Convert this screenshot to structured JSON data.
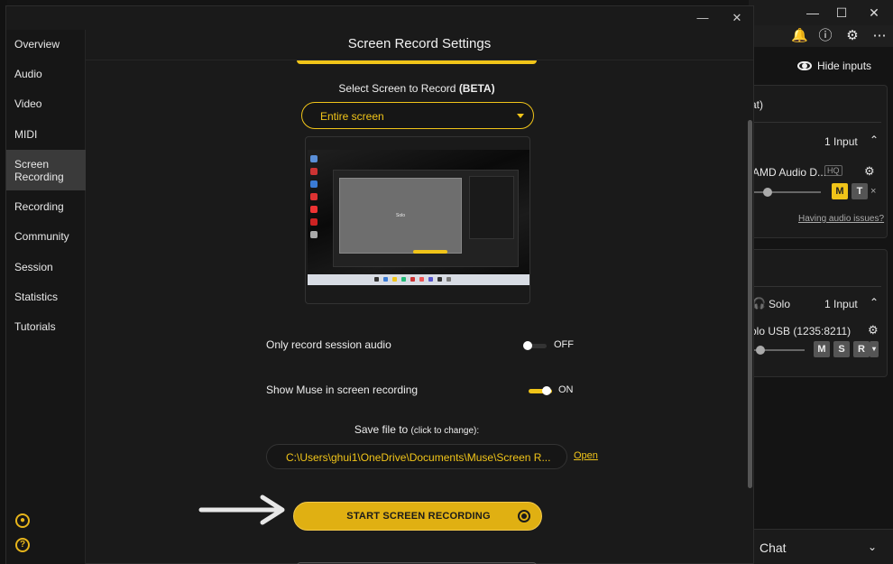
{
  "background_app": {
    "hide_inputs_label": "Hide inputs",
    "input1": {
      "title_fragment": "at)",
      "count": "1 Input",
      "device": "AMD Audio D...",
      "hq": "HQ",
      "mute": "M",
      "talk": "T",
      "close": "×",
      "help_link": "Having audio issues?"
    },
    "input2": {
      "name": "Solo",
      "count": "1 Input",
      "device": "olo USB (1235:8211)",
      "mute": "M",
      "solo": "S",
      "record": "R"
    },
    "chat_label": "Chat"
  },
  "modal": {
    "title": "Screen Record Settings",
    "close": "✕",
    "minimize": "—",
    "sidebar": [
      {
        "label": "Overview"
      },
      {
        "label": "Audio"
      },
      {
        "label": "Video"
      },
      {
        "label": "MIDI"
      },
      {
        "label": "Screen\nRecording",
        "active": true
      },
      {
        "label": "Recording"
      },
      {
        "label": "Community"
      },
      {
        "label": "Session"
      },
      {
        "label": "Statistics"
      },
      {
        "label": "Tutorials"
      }
    ],
    "select_label": "Select Screen to Record ",
    "select_beta": "(BETA)",
    "dropdown_value": "Entire screen",
    "preview_center_text": "Solo",
    "session_audio": {
      "label": "Only record session audio",
      "state": "OFF",
      "on": false
    },
    "show_muse": {
      "label": "Show Muse in screen recording",
      "state": "ON",
      "on": true
    },
    "save_label": "Save file to ",
    "save_hint": "(click to change):",
    "save_path": "C:\\Users\\ghui1\\OneDrive\\Documents\\Muse\\Screen R...",
    "open_link": "Open",
    "start_button": "START SCREEN RECORDING"
  },
  "colors": {
    "accent": "#f0c419",
    "background": "#1a1a1a"
  }
}
